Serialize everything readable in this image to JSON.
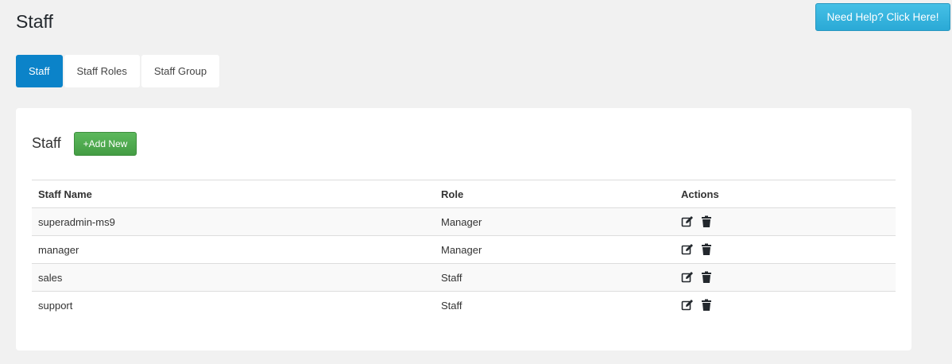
{
  "page": {
    "title": "Staff"
  },
  "header": {
    "help_button": "Need Help? Click Here!"
  },
  "tabs": [
    {
      "label": "Staff",
      "active": true
    },
    {
      "label": "Staff Roles",
      "active": false
    },
    {
      "label": "Staff Group",
      "active": false
    }
  ],
  "card": {
    "title": "Staff",
    "add_button": "+Add New"
  },
  "table": {
    "columns": [
      "Staff Name",
      "Role",
      "Actions"
    ],
    "rows": [
      {
        "name": "superadmin-ms9",
        "role": "Manager"
      },
      {
        "name": "manager",
        "role": "Manager"
      },
      {
        "name": "sales",
        "role": "Staff"
      },
      {
        "name": "support",
        "role": "Staff"
      }
    ],
    "action_icons": [
      "edit-icon",
      "trash-icon"
    ]
  },
  "colors": {
    "background": "#f1f1f1",
    "active_tab": "#0b83c9",
    "help_button": "#2aa9d6",
    "add_button": "#4cae4c"
  }
}
